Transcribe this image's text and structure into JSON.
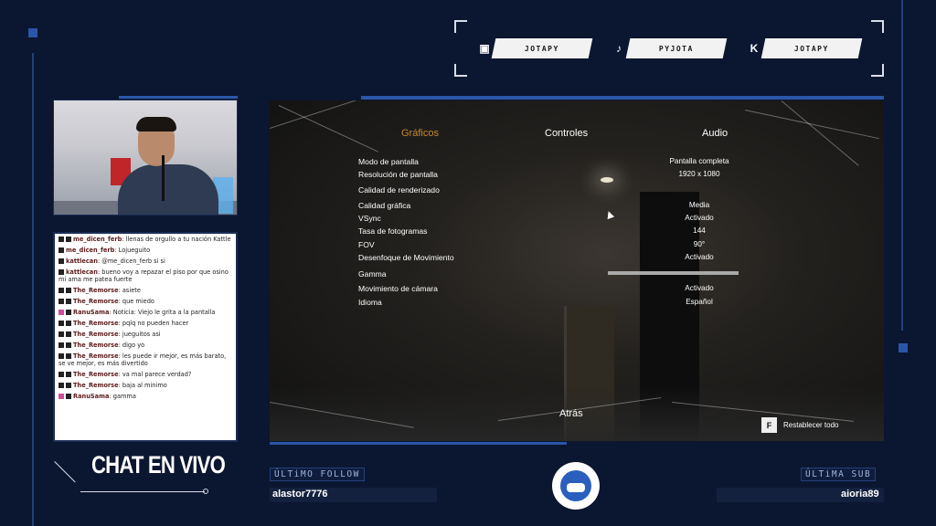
{
  "socials": [
    {
      "icon": "twitch-icon",
      "glyph": "▣",
      "label": "JOTAPY"
    },
    {
      "icon": "tiktok-icon",
      "glyph": "♪",
      "label": "PYJOTA"
    },
    {
      "icon": "kick-icon",
      "glyph": "K",
      "label": "JOTAPY"
    }
  ],
  "chat": {
    "title": "CHAT EN VIVO",
    "messages": [
      {
        "badges": [
          "",
          ""
        ],
        "user": "me_dicen_ferb",
        "text": "llenas de orgullo a tu nación Kattle"
      },
      {
        "badges": [
          ""
        ],
        "user": "me_dicen_ferb",
        "text": "Lojueguito"
      },
      {
        "badges": [
          ""
        ],
        "user": "kattlecan",
        "text": "@me_dicen_ferb si si"
      },
      {
        "badges": [
          ""
        ],
        "user": "kattlecan",
        "text": "bueno voy a repazar el piso por que osino mi ama me patea fuerte"
      },
      {
        "badges": [
          "",
          ""
        ],
        "user": "The_Remorse",
        "text": "asiete"
      },
      {
        "badges": [
          "",
          ""
        ],
        "user": "The_Remorse",
        "text": "que miedo"
      },
      {
        "badges": [
          "pink",
          ""
        ],
        "user": "RanuSama",
        "text": "Noticia: Viejo le grita a la pantalla"
      },
      {
        "badges": [
          "",
          ""
        ],
        "user": "The_Remorse",
        "text": "pqlq no pueden hacer"
      },
      {
        "badges": [
          "",
          ""
        ],
        "user": "The_Remorse",
        "text": "jueguitos asi"
      },
      {
        "badges": [
          "",
          ""
        ],
        "user": "The_Remorse",
        "text": "digo yo"
      },
      {
        "badges": [
          "",
          ""
        ],
        "user": "The_Remorse",
        "text": "les puede ir mejor, es más barato, se ve mejor, es más divertido"
      },
      {
        "badges": [
          "",
          ""
        ],
        "user": "The_Remorse",
        "text": "va mal parece verdad?"
      },
      {
        "badges": [
          "",
          ""
        ],
        "user": "The_Remorse",
        "text": "baja al minimo"
      },
      {
        "badges": [
          "pink",
          ""
        ],
        "user": "RanuSama",
        "text": "gamma"
      }
    ]
  },
  "game": {
    "tabs": [
      "Gráficos",
      "Controles",
      "Audio"
    ],
    "active_tab": "Gráficos",
    "settings": [
      {
        "label": "Modo de pantalla",
        "value": "Pantalla completa"
      },
      {
        "label": "Resolución de pantalla",
        "value": "1920 x 1080"
      },
      {
        "label": "Calidad de renderizado",
        "value": ""
      },
      {
        "label": "Calidad gráfica",
        "value": "Media"
      },
      {
        "label": "VSync",
        "value": "Activado"
      },
      {
        "label": "Tasa de fotogramas",
        "value": "144"
      },
      {
        "label": "FOV",
        "value": "90°"
      },
      {
        "label": "Desenfoque de Movimiento",
        "value": "Activado"
      },
      {
        "label": "Gamma",
        "value": ""
      },
      {
        "label": "Movimiento de cámara",
        "value": "Activado"
      },
      {
        "label": "Idioma",
        "value": "Español"
      }
    ],
    "back_label": "Atrás",
    "reset_key": "F",
    "reset_label": "Restablecer todo"
  },
  "bottom": {
    "last_follow_label": "ÚLTiMO FOLLOW",
    "last_follow_value": "alastor7776",
    "last_sub_label": "ÚLTiMA SUB",
    "last_sub_value": "aioria89"
  }
}
